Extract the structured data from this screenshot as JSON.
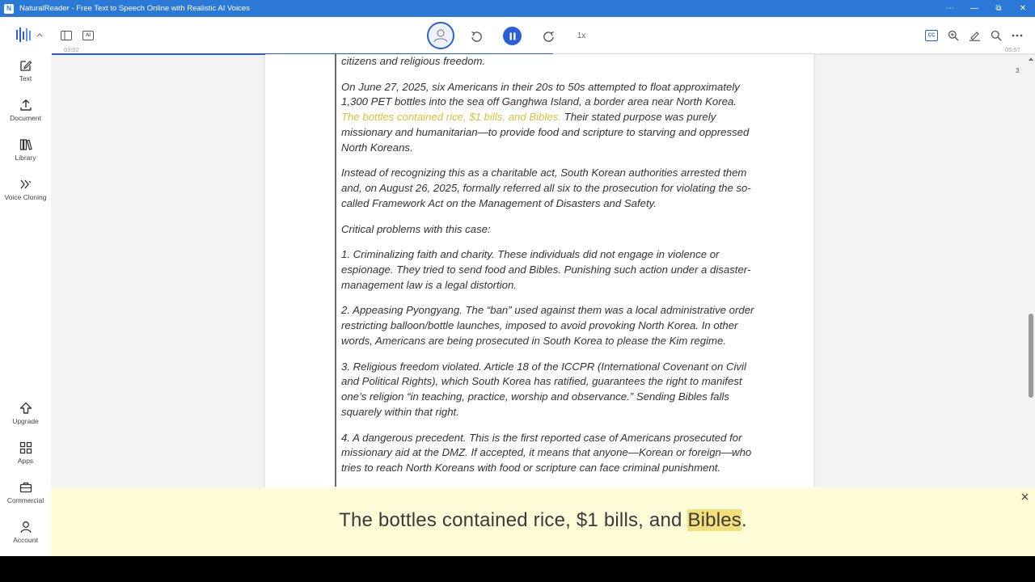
{
  "window": {
    "icon_letter": "N",
    "title": "NaturalReader - Free Text to Speech Online with Realistic AI Voices",
    "controls": [
      "⋯",
      "—",
      "⧉",
      "✕"
    ]
  },
  "toolbar": {
    "speed": "1x",
    "time_elapsed": "03:02",
    "time_total": "05:57",
    "progress_percent": 51,
    "ai_label": "AI",
    "cc_label": "CC"
  },
  "sidebar": {
    "items": [
      {
        "label": "Text",
        "icon": "edit-icon"
      },
      {
        "label": "Document",
        "icon": "upload-icon"
      },
      {
        "label": "Library",
        "icon": "library-icon"
      },
      {
        "label": "Voice Cloning",
        "icon": "voice-cloning-icon"
      }
    ],
    "bottom_items": [
      {
        "label": "Upgrade",
        "icon": "upgrade-icon"
      },
      {
        "label": "Apps",
        "icon": "apps-icon"
      },
      {
        "label": "Commercial",
        "icon": "briefcase-icon"
      },
      {
        "label": "Account",
        "icon": "account-icon"
      }
    ]
  },
  "document": {
    "page_number": "3",
    "p0": "citizens and religious freedom.",
    "p1_a": "On June 27, 2025, six Americans in their 20s to 50s attempted to float approximately 1,300 PET bottles into the sea off Ganghwa Island, a border area near North Korea. ",
    "p1_highlight": "The bottles contained rice, $1 bills, and Bibles.",
    "p1_b": " Their stated purpose was purely missionary and humanitarian—to provide food and scripture to starving and oppressed North Koreans.",
    "p2": "Instead of recognizing this as a charitable act, South Korean authorities arrested them and, on August 26, 2025, formally referred all six to the prosecution for violating the so-called Framework Act on the Management of Disasters and Safety.",
    "p3": "Critical problems with this case:",
    "p4": "1. Criminalizing faith and charity. These individuals did not engage in violence or espionage. They tried to send food and Bibles. Punishing such action under a disaster-management law is a legal distortion.",
    "p5": "2. Appeasing Pyongyang. The “ban” used against them was a local administrative order restricting balloon/bottle launches, imposed to avoid provoking North Korea. In other words, Americans are being prosecuted in South Korea to please the Kim regime.",
    "p6": "3. Religious freedom violated. Article 18 of the ICCPR (International Covenant on Civil and Political Rights), which South Korea has ratified, guarantees the right to manifest one’s religion “in teaching, practice, worship and observance.” Sending Bibles falls squarely within that right.",
    "p7": "4. A dangerous precedent. This is the first reported case of Americans prosecuted for missionary aid at the DMZ. If accepted, it means that anyone—Korean or foreign—who tries to reach North Koreans with food or scripture can face criminal punishment."
  },
  "caption": {
    "before": "The bottles contained rice, $1 bills, and ",
    "current_word": "Bibles",
    "after": "."
  },
  "colors": {
    "titlebar": "#2b78d6",
    "accent": "#2b5fd9",
    "doc_highlight": "#d2c43a",
    "caption_bg": "#fefbd7",
    "caption_word_bg": "#f4e07a"
  }
}
